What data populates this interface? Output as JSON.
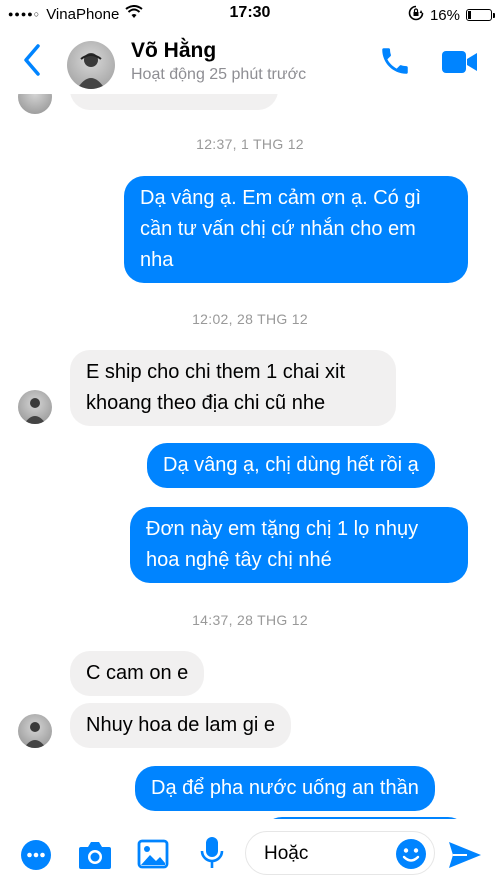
{
  "status_bar": {
    "carrier": "VinaPhone",
    "signal": "●●●●○",
    "time": "17:30",
    "battery_percent": "16%",
    "battery_level": 0.16
  },
  "header": {
    "name": "Võ Hằng",
    "status": "Hoạt động 25 phút trước"
  },
  "conversation": {
    "stamp_1": "12:37, 1 THG 12",
    "msg_1": "Dạ vâng ạ. Em cảm ơn ạ. Có gì cần tư vấn chị cứ nhắn cho em nha",
    "stamp_2": "12:02, 28 THG 12",
    "msg_2": "E ship cho chi them 1 chai xit khoang theo địa chi cũ nhe",
    "msg_3": "Dạ vâng ạ, chị dùng hết rồi ạ",
    "msg_4": "Đơn này em tặng chị 1 lọ nhụy hoa nghệ tây chị nhé",
    "stamp_3": "14:37, 28 THG 12",
    "msg_5": "C cam on e",
    "msg_6": "Nhuy hoa de lam gi e",
    "msg_7": "Dạ để pha nước uống an thần"
  },
  "composer": {
    "input_text": "Hoặc"
  },
  "colors": {
    "accent": "#0084ff",
    "incoming_bubble": "#f1f0f0",
    "timestamp": "#999999"
  },
  "icons": [
    "signal-icon",
    "wifi-icon",
    "rotation-lock-icon",
    "battery-icon",
    "back-chevron-icon",
    "phone-icon",
    "video-camera-icon",
    "more-icon",
    "camera-icon",
    "gallery-icon",
    "microphone-icon",
    "emoji-icon",
    "send-icon"
  ]
}
